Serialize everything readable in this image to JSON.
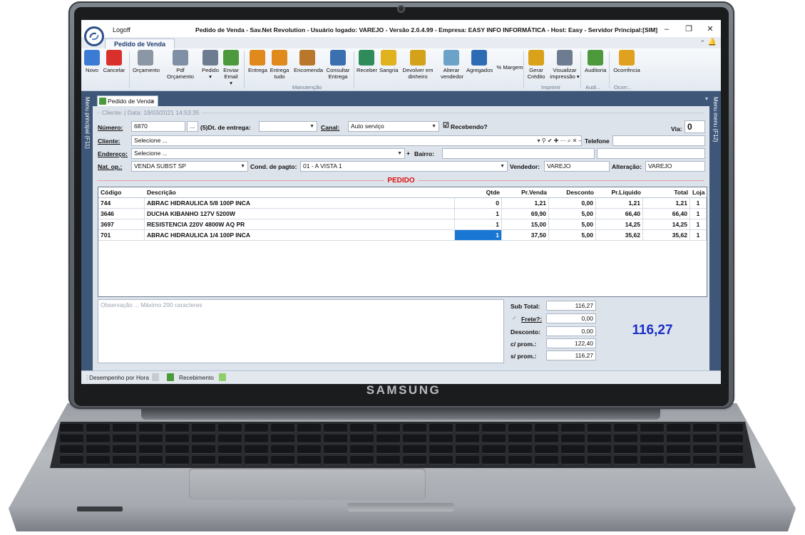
{
  "device": {
    "brand": "SAMSUNG"
  },
  "window": {
    "logoff": "Logoff",
    "title": "Pedido de Venda - Sav.Net Revolution - Usuário logado: VAREJO - Versão 2.0.4.99 - Empresa: EASY INFO INFORMÁTICA - Host: Easy - Servidor Principal:[SIM]",
    "minimize": "–",
    "restore": "❐",
    "close": "✕"
  },
  "ribbon": {
    "tab": "Pedido de Venda",
    "buttons": [
      {
        "label": "Novo",
        "icon": "new-icon",
        "color": "#3b7bd4"
      },
      {
        "label": "Cancelar",
        "icon": "cancel-icon",
        "color": "#d9302c"
      },
      {
        "label": "Orçamento",
        "icon": "budget-icon",
        "color": "#8c97a6"
      },
      {
        "label": "Pdf Orçamento",
        "icon": "pdf-icon",
        "color": "#7f8fa6"
      },
      {
        "label": "Pedido ▾",
        "icon": "print-icon",
        "color": "#6d7c90"
      },
      {
        "label": "Enviar Email ▾",
        "icon": "email-icon",
        "color": "#4c9a3c"
      },
      {
        "label": "Entrega",
        "icon": "truck-icon",
        "color": "#e08a1e"
      },
      {
        "label": "Entrega tudo",
        "icon": "truck-plus-icon",
        "color": "#e08a1e"
      },
      {
        "label": "Encomenda",
        "icon": "box-icon",
        "color": "#b9772c"
      },
      {
        "label": "Consultar Entrega",
        "icon": "consult-truck-icon",
        "color": "#3a6fb0"
      },
      {
        "label": "Receber",
        "icon": "cash-register-icon",
        "color": "#2f8c5a"
      },
      {
        "label": "Sangria",
        "icon": "withdraw-icon",
        "color": "#e0b21e"
      },
      {
        "label": "Devolver em dinheiro",
        "icon": "refund-icon",
        "color": "#d4a21a"
      },
      {
        "label": "Alterar vendedor",
        "icon": "user-switch-icon",
        "color": "#6aa2c8"
      },
      {
        "label": "Agregados",
        "icon": "aggregate-icon",
        "color": "#2d6cb5"
      },
      {
        "label": "% Margem",
        "icon": "",
        "color": ""
      },
      {
        "label": "Gerar Crédito",
        "icon": "credit-icon",
        "color": "#d9a21a"
      },
      {
        "label": "Visualizar impressão ▾",
        "icon": "print-preview-icon",
        "color": "#6d7c90"
      },
      {
        "label": "Auditoria",
        "icon": "audit-icon",
        "color": "#4c9a3c"
      },
      {
        "label": "Ocorrência",
        "icon": "warning-icon",
        "color": "#e0a21e"
      }
    ],
    "groups": [
      "Manutenção",
      "Imprimir",
      "Audi...",
      "Ocorr..."
    ]
  },
  "sidebar": {
    "left": "Menu principal (F11)",
    "right": "Menu menu (F12)"
  },
  "document_tab": {
    "label": "Pedido de Venda",
    "close": "×"
  },
  "form": {
    "frame_title": "Cliente:  | Data: 19/03/2021 14:53:35",
    "numero_label": "Número:",
    "numero": "6870",
    "ellipsis": "...",
    "dt_entrega_label": "(5)Dt. de entrega:",
    "dt_entrega": "",
    "canal_label": "Canal:",
    "canal": "Auto serviço",
    "recebendo_label": "Recebendo?",
    "via_label": "Via:",
    "via": "0",
    "cliente_label": "Cliente:",
    "cliente": "Selecione ...",
    "cliente_tools": "▾ ⚲ ✔ ✚ ⋯ ⌕ ✕ –",
    "telefone_label": "Telefone",
    "telefone": "",
    "endereco_label": "Endereço:",
    "endereco": "Selecione ...",
    "endereco_add": "+",
    "bairro_label": "Bairro:",
    "bairro": "",
    "bairro_extra": "",
    "natop_label": "Nat. op.:",
    "natop": "VENDA SUBST SP",
    "cond_label": "Cond. de pagto:",
    "cond": "01 - A VISTA 1",
    "vendedor_label": "Vendedor:",
    "vendedor": "VAREJO",
    "alteracao_label": "Alteração:",
    "alteracao": "VAREJO"
  },
  "pedido": {
    "title": "PEDIDO",
    "columns": [
      "Código",
      "Descrição",
      "Qtde",
      "Pr.Venda",
      "Desconto",
      "Pr.Líquido",
      "Total",
      "Loja"
    ],
    "rows": [
      [
        "744",
        "ABRAC HIDRAULICA 5/8 100P INCA",
        "0",
        "1,21",
        "0,00",
        "1,21",
        "1,21",
        "1"
      ],
      [
        "3646",
        "DUCHA KIBANHO 127V 5200W",
        "1",
        "69,90",
        "5,00",
        "66,40",
        "66,40",
        "1"
      ],
      [
        "3697",
        "RESISTENCIA 220V 4800W AQ PR",
        "1",
        "15,00",
        "5,00",
        "14,25",
        "14,25",
        "1"
      ],
      [
        "701",
        "ABRAC HIDRAULICA 1/4 100P INCA",
        "1",
        "37,50",
        "5,00",
        "35,62",
        "35,62",
        "1"
      ]
    ]
  },
  "observacao": {
    "placeholder": "Observação ... Máximo 200 caracteres"
  },
  "totals": {
    "subtotal_label": "Sub Total:",
    "subtotal": "116,27",
    "frete_label": "Frete?:",
    "frete": "0,00",
    "desconto_label": "Desconto:",
    "desconto": "0,00",
    "cprom_label": "c/ prom.:",
    "cprom": "122,40",
    "sprom_label": "s/ prom.:",
    "sprom": "116,27",
    "grand_total": "116,27"
  },
  "statusbar": {
    "desempenho": "Desempenho por Hora",
    "recebimento": "Recebimento"
  },
  "colors": {
    "accent": "#1976d2",
    "total_blue": "#1a2fc7",
    "pedido_red": "#dd1111",
    "frame_navy": "#3e5677"
  }
}
